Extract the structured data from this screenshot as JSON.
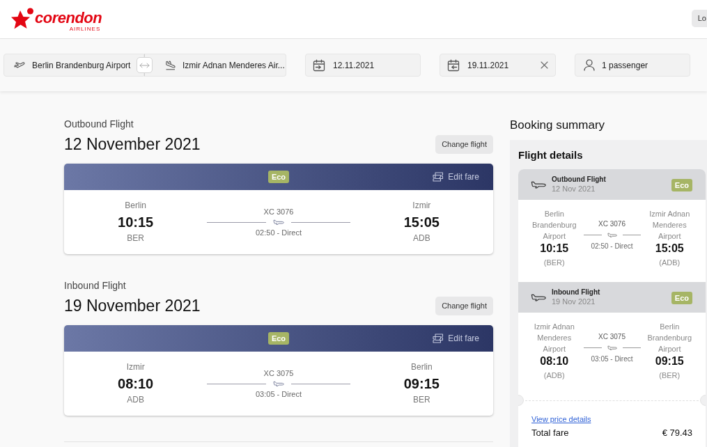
{
  "header": {
    "logo": {
      "name": "corendon",
      "tagline": "AIRLINES"
    },
    "login_button": "Lo"
  },
  "search": {
    "origin": "Berlin Brandenburg Airport",
    "destination": "Izmir Adnan Menderes Air...",
    "departure_date": "12.11.2021",
    "return_date": "19.11.2021",
    "passengers": "1 passenger"
  },
  "flights": [
    {
      "label": "Outbound Flight",
      "date": "12 November 2021",
      "change_button": "Change flight",
      "fare": "Eco",
      "edit_fare": "Edit fare",
      "from": {
        "city": "Berlin",
        "time": "10:15",
        "code": "BER"
      },
      "flight_number": "XC 3076",
      "duration": "02:50 - Direct",
      "to": {
        "city": "Izmir",
        "time": "15:05",
        "code": "ADB"
      }
    },
    {
      "label": "Inbound Flight",
      "date": "19 November 2021",
      "change_button": "Change flight",
      "fare": "Eco",
      "edit_fare": "Edit fare",
      "from": {
        "city": "Izmir",
        "time": "08:10",
        "code": "ADB"
      },
      "flight_number": "XC 3075",
      "duration": "03:05 - Direct",
      "to": {
        "city": "Berlin",
        "time": "09:15",
        "code": "BER"
      }
    }
  ],
  "summary": {
    "title": "Booking summary",
    "section_title": "Flight details",
    "flights": [
      {
        "label": "Outbound Flight",
        "date": "12 Nov 2021",
        "fare": "Eco",
        "from": {
          "airport": "Berlin Brandenburg Airport",
          "time": "10:15",
          "code": "(BER)"
        },
        "flight_number": "XC 3076",
        "duration": "02:50 - Direct",
        "to": {
          "airport": "Izmir Adnan Menderes Airport",
          "time": "15:05",
          "code": "(ADB)"
        }
      },
      {
        "label": "Inbound Flight",
        "date": "19 Nov 2021",
        "fare": "Eco",
        "from": {
          "airport": "Izmir Adnan Menderes Airport",
          "time": "08:10",
          "code": "(ADB)"
        },
        "flight_number": "XC 3075",
        "duration": "03:05 - Direct",
        "to": {
          "airport": "Berlin Brandenburg Airport",
          "time": "09:15",
          "code": "(BER)"
        }
      }
    ],
    "price_link": "View price details",
    "total_label": "Total fare",
    "total": "€ 79.43"
  }
}
